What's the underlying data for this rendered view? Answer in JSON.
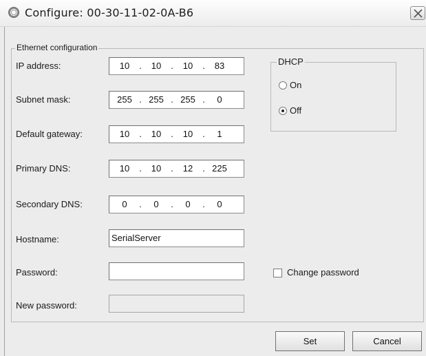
{
  "window": {
    "title": "Configure: 00-30-11-02-0A-B6",
    "icon": "gear-icon",
    "close_icon": "close-icon"
  },
  "ethernet_group": {
    "legend": "Ethernet configuration",
    "ip_address": {
      "label": "IP address:",
      "octets": [
        "10",
        "10",
        "10",
        "83"
      ]
    },
    "subnet_mask": {
      "label": "Subnet mask:",
      "octets": [
        "255",
        "255",
        "255",
        "0"
      ]
    },
    "default_gateway": {
      "label": "Default gateway:",
      "octets": [
        "10",
        "10",
        "10",
        "1"
      ]
    },
    "primary_dns": {
      "label": "Primary DNS:",
      "octets": [
        "10",
        "10",
        "12",
        "225"
      ]
    },
    "secondary_dns": {
      "label": "Secondary DNS:",
      "octets": [
        "0",
        "0",
        "0",
        "0"
      ]
    },
    "hostname": {
      "label": "Hostname:",
      "value": "SerialServer"
    },
    "password": {
      "label": "Password:",
      "value": ""
    },
    "new_password": {
      "label": "New password:",
      "value": ""
    },
    "dot": "."
  },
  "dhcp": {
    "legend": "DHCP",
    "options": [
      {
        "label": "On",
        "selected": false
      },
      {
        "label": "Off",
        "selected": true
      }
    ]
  },
  "change_password": {
    "label": "Change password",
    "checked": false
  },
  "buttons": {
    "set": "Set",
    "cancel": "Cancel"
  }
}
